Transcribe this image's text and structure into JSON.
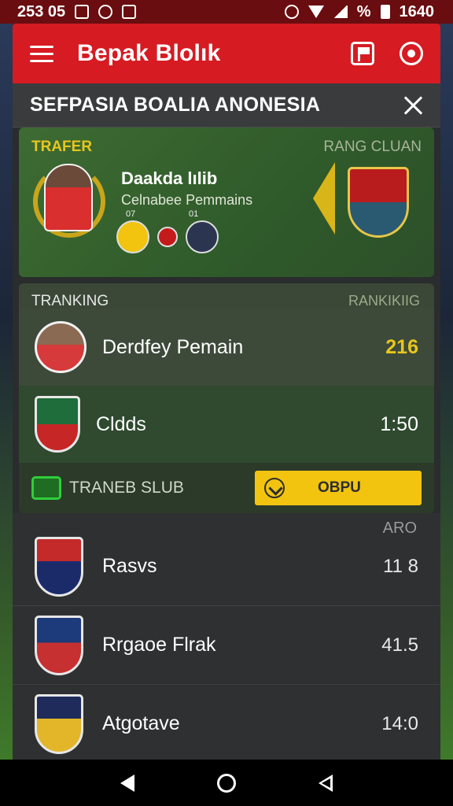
{
  "status_bar": {
    "time_left": "253 05",
    "time_right": "1640",
    "percent": "%"
  },
  "header": {
    "title": "Bepak Blolık"
  },
  "sub_header": {
    "title": "SEFPASIA BOALIA ANONESIA"
  },
  "transfer": {
    "label_left": "TRAFER",
    "label_right": "RANG CLUAN",
    "player_name": "Daakda lılib",
    "player_subtitle": "Celnabee Pemmains",
    "badge_tag_1": "07",
    "badge_tag_2": "01"
  },
  "ranking": {
    "label_left": "TRANKING",
    "label_right": "RANKIKIIG",
    "rows": [
      {
        "name": "Derdfey Pemain",
        "value": "216"
      },
      {
        "name": "Cldds",
        "value": "1:50"
      }
    ],
    "bottom_label": "TRANEB SLUB",
    "bottom_button": "OBPU"
  },
  "list": {
    "tag": "ARO",
    "rows": [
      {
        "name": "Rasvs",
        "value": "11 8"
      },
      {
        "name": "Rrgaoe Flrak",
        "value": "41.5"
      },
      {
        "name": "Atgotave",
        "value": "14:0"
      }
    ]
  },
  "colors": {
    "header_red": "#d61b22",
    "accent_gold": "#e8c61d",
    "button_yellow": "#f2c40f"
  }
}
